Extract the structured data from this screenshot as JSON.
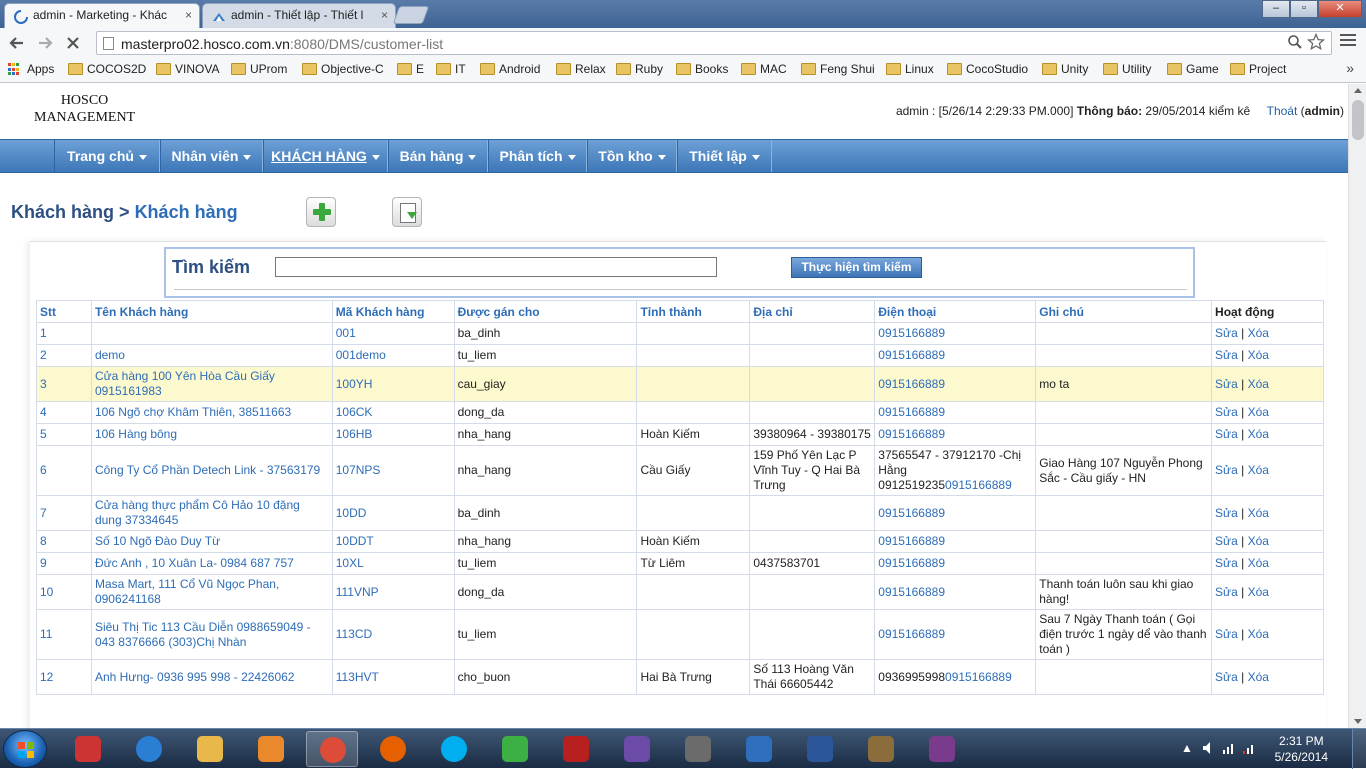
{
  "browser": {
    "tabs": [
      {
        "title": "admin - Marketing - Khác",
        "close": "×"
      },
      {
        "title": "admin - Thiết lập - Thiết l",
        "close": "×"
      }
    ],
    "url_host": "masterpro02.hosco.com.vn",
    "url_rest": ":8080/DMS/customer-list",
    "bookmarks": [
      "Apps",
      "COCOS2D",
      "VINOVA",
      "UProm",
      "Objective-C",
      "E",
      "IT",
      "Android",
      "Relax",
      "Ruby",
      "Books",
      "MAC",
      "Feng Shui",
      "Linux",
      "CocoStudio",
      "Unity",
      "Utility",
      "Game",
      "Project"
    ],
    "bookmarks_more": "»",
    "window_buttons": {
      "minimize": "–",
      "maximize": "▫",
      "close": "✕"
    },
    "nav_icons": {
      "back": "back-arrow-icon",
      "forward": "forward-arrow-icon",
      "reload": "stop-reload-icon"
    }
  },
  "header": {
    "logo_line1": "HOSCO",
    "logo_line2": "MANAGEMENT",
    "user_prefix": "admin : [5/26/14 2:29:33 PM.000]",
    "notice_label": "Thông báo:",
    "notice_text": "29/05/2014 kiểm kê",
    "logout_label": "Thoát",
    "logout_user": "admin"
  },
  "nav": [
    {
      "label": "Trang chủ",
      "active": false
    },
    {
      "label": "Nhân viên",
      "active": false
    },
    {
      "label": "KHÁCH HÀNG",
      "active": true
    },
    {
      "label": "Bán hàng",
      "active": false
    },
    {
      "label": "Phân tích",
      "active": false
    },
    {
      "label": "Tồn kho",
      "active": false
    },
    {
      "label": "Thiết lập",
      "active": false
    }
  ],
  "breadcrumb": {
    "parent": "Khách hàng",
    "sep": ">",
    "current": "Khách hàng"
  },
  "search": {
    "label": "Tìm kiếm",
    "value": "",
    "button": "Thực hiện tìm kiếm"
  },
  "table": {
    "headers": [
      "Stt",
      "Tên Khách hàng",
      "Mã Khách hàng",
      "Được gán cho",
      "Tỉnh thành",
      "Địa chỉ",
      "Điện thoại",
      "Ghi chú",
      "Hoạt động"
    ],
    "edit_label": "Sửa",
    "delete_label": "Xóa",
    "action_sep": "|",
    "rows": [
      {
        "stt": "1",
        "name": "",
        "code": "001",
        "assigned": "ba_dinh",
        "city": "",
        "address": "",
        "phone": "0915166889",
        "note": ""
      },
      {
        "stt": "2",
        "name": "demo",
        "code": "001demo",
        "assigned": "tu_liem",
        "city": "",
        "address": "",
        "phone": "0915166889",
        "note": ""
      },
      {
        "stt": "3",
        "name": "Cửa hàng 100 Yên Hòa Cầu Giấy 0915161983",
        "code": "100YH",
        "assigned": "cau_giay",
        "city": "",
        "address": "",
        "phone": "0915166889",
        "note": "mo ta"
      },
      {
        "stt": "4",
        "name": "106 Ngõ chợ Khâm Thiên, 38511663",
        "code": "106CK",
        "assigned": "dong_da",
        "city": "",
        "address": "",
        "phone": "0915166889",
        "note": ""
      },
      {
        "stt": "5",
        "name": "106 Hàng bông",
        "code": "106HB",
        "assigned": "nha_hang",
        "city": "Hoàn Kiếm",
        "address": "39380964 - 39380175",
        "phone": "0915166889",
        "note": ""
      },
      {
        "stt": "6",
        "name": "Công Ty Cổ Phần Detech Link - 37563179",
        "code": "107NPS",
        "assigned": "nha_hang",
        "city": "Cầu Giấy",
        "address": "159 Phố Yên Lạc P Vĩnh Tuy - Q Hai Bà Trưng",
        "phone_prefix": "37565547 - 37912170 -Chị Hằng 0912519235",
        "phone": "0915166889",
        "note": "Giao Hàng 107 Nguyễn Phong Sắc - Cầu giấy - HN"
      },
      {
        "stt": "7",
        "name": "Cửa hàng thực phẩm Cô Hảo 10 đặng dung 37334645",
        "code": "10DD",
        "assigned": "ba_dinh",
        "city": "",
        "address": "",
        "phone": "0915166889",
        "note": ""
      },
      {
        "stt": "8",
        "name": "Số 10 Ngõ Đào Duy Từ",
        "code": "10DDT",
        "assigned": "nha_hang",
        "city": "Hoàn Kiếm",
        "address": "",
        "phone": "0915166889",
        "note": ""
      },
      {
        "stt": "9",
        "name": "Đức Anh , 10 Xuân La- 0984 687 757",
        "code": "10XL",
        "assigned": "tu_liem",
        "city": "Từ Liêm",
        "address": "0437583701",
        "phone": "0915166889",
        "note": ""
      },
      {
        "stt": "10",
        "name": "Masa Mart, 111 Cổ Vũ Ngọc Phan, 0906241168",
        "code": "111VNP",
        "assigned": "dong_da",
        "city": "",
        "address": "",
        "phone": "0915166889",
        "note": "Thanh toán luôn sau khi giao hàng!"
      },
      {
        "stt": "11",
        "name": "Siêu Thị Tic 113 Cầu Diễn 0988659049 - 043 8376666 (303)Chị Nhàn",
        "code": "113CD",
        "assigned": "tu_liem",
        "city": "",
        "address": "",
        "phone": "0915166889",
        "note": "Sau 7 Ngày Thanh toán ( Gọi điện trước 1 ngày dể vào thanh toán )"
      },
      {
        "stt": "12",
        "name": "Anh Hưng- 0936 995 998 - 22426062",
        "code": "113HVT",
        "assigned": "cho_buon",
        "city": "Hai Bà Trưng",
        "address": "Số 113 Hoàng Văn Thái 66605442",
        "phone_prefix": "0936995998",
        "phone": "0915166889",
        "note": ""
      }
    ]
  },
  "taskbar": {
    "apps": [
      "windows-media-center-icon",
      "internet-explorer-icon",
      "file-explorer-icon",
      "media-player-icon",
      "chrome-icon",
      "firefox-icon",
      "skype-icon",
      "clover-icon",
      "red-bag-icon",
      "visual-studio-icon",
      "sublime-text-icon",
      "pidgin-icon",
      "word-icon",
      "paint-icon",
      "winrar-icon"
    ],
    "time": "2:31 PM",
    "date": "5/26/2014",
    "tray_expand": "▲"
  },
  "colors": {
    "nav_bar": "#3d77b8",
    "link": "#2e6db7",
    "highlight_row": "#fdf9cf",
    "heading": "#2d4f82"
  }
}
